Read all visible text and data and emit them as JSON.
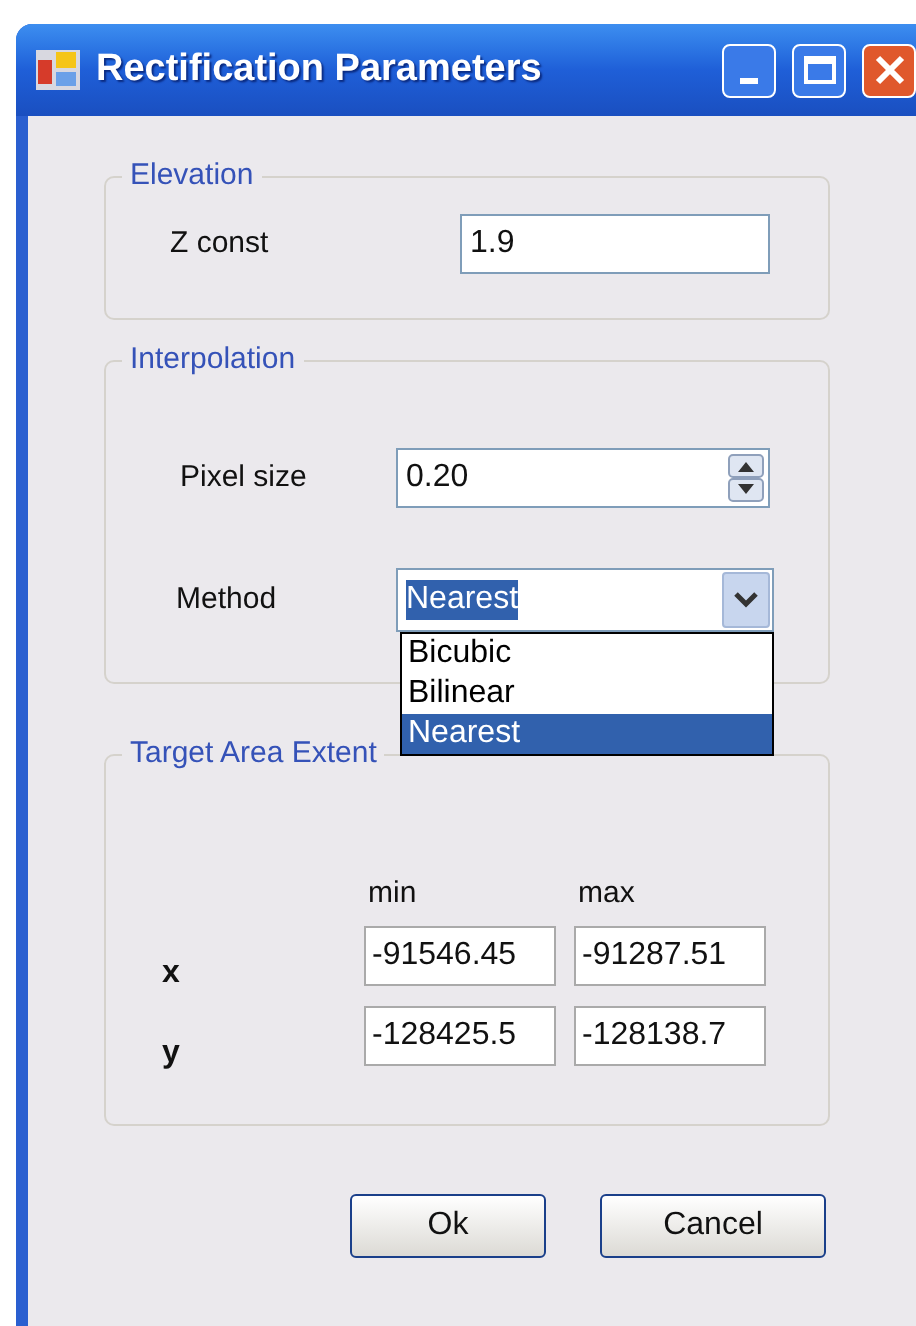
{
  "window": {
    "title": "Rectification Parameters"
  },
  "elevation": {
    "title": "Elevation",
    "z_const": {
      "label": "Z const",
      "value": "1.9"
    }
  },
  "interpolation": {
    "title": "Interpolation",
    "pixel_size": {
      "label": "Pixel size",
      "value": "0.20"
    },
    "method": {
      "label": "Method",
      "value": "Nearest",
      "expanded": true,
      "options": [
        {
          "label": "Bicubic",
          "selected": false
        },
        {
          "label": "Bilinear",
          "selected": false
        },
        {
          "label": "Nearest",
          "selected": true
        }
      ]
    }
  },
  "target_area": {
    "title": "Target Area Extent",
    "columns": [
      "min",
      "max"
    ],
    "rows": [
      {
        "label": "x",
        "min": "-91546.45",
        "max": "-91287.51"
      },
      {
        "label": "y",
        "min": "-128425.5",
        "max": "-128138.7"
      }
    ]
  },
  "buttons": [
    "Ok",
    "Cancel"
  ]
}
